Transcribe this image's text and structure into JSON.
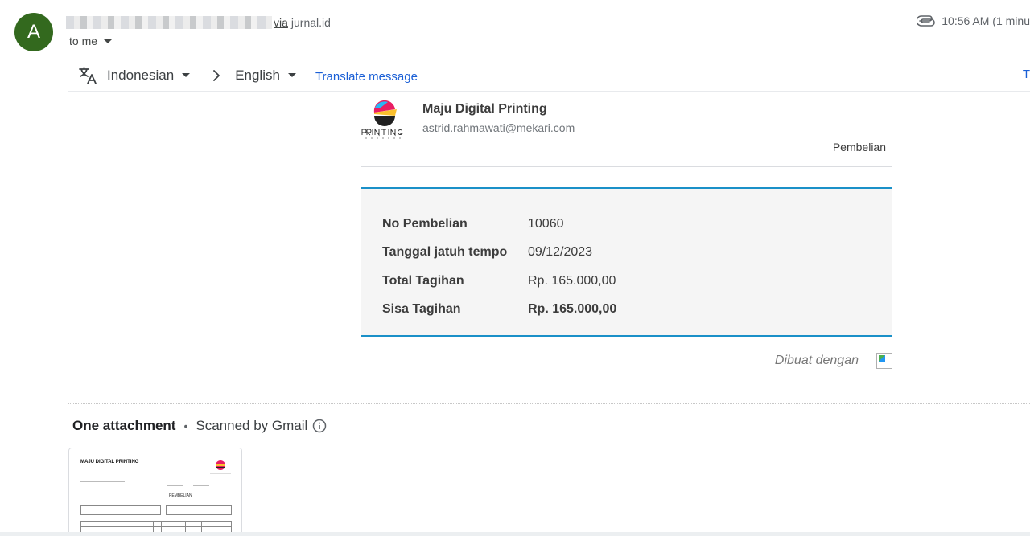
{
  "sender": {
    "avatar_letter": "A",
    "via_label": "via",
    "via_domain": "jurnal.id",
    "recipient": "to me",
    "time": "10:56 AM (1 minu"
  },
  "translate_bar": {
    "source_language": "Indonesian",
    "target_language": "English",
    "translate_link": "Translate message",
    "edge_text": "T"
  },
  "email": {
    "company_name": "Maju Digital Printing",
    "company_email": "astrid.rahmawati@mekari.com",
    "document_type": "Pembelian",
    "summary": [
      {
        "label": "No Pembelian",
        "value": "10060"
      },
      {
        "label": "Tanggal jatuh tempo",
        "value": "09/12/2023"
      },
      {
        "label": "Total Tagihan",
        "value": "Rp. 165.000,00"
      },
      {
        "label": "Sisa Tagihan",
        "value": "Rp. 165.000,00"
      }
    ],
    "footer_text": "Dibuat dengan"
  },
  "attachments": {
    "title": "One attachment",
    "separator": "•",
    "scanned_text": "Scanned by Gmail",
    "thumbnail": {
      "title": "MAJU DIGITAL PRINTING",
      "section": "PEMBELIAN"
    }
  },
  "colors": {
    "avatar": "#33691e",
    "link": "#1a5fd6",
    "summary_border": "#1a90c8"
  }
}
